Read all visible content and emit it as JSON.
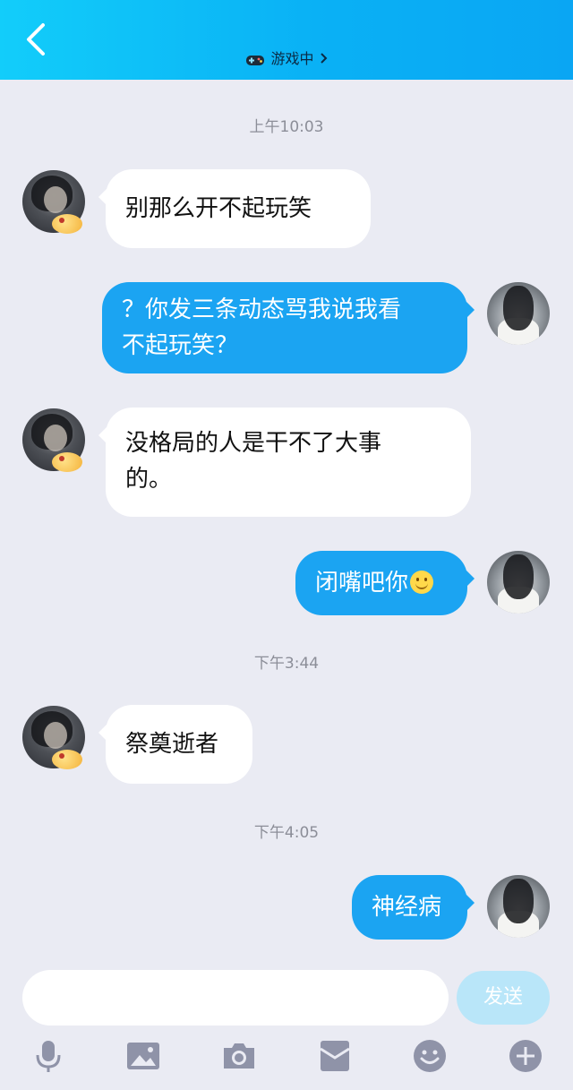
{
  "header": {
    "status_label": "游戏中"
  },
  "timestamps": [
    "上午10:03",
    "下午3:44",
    "下午4:05"
  ],
  "messages": [
    {
      "side": "in",
      "text": "别那么开不起玩笑"
    },
    {
      "side": "out",
      "line1": "？你发三条动态骂我说我看",
      "line2": "不起玩笑？"
    },
    {
      "side": "in",
      "line1": "没格局的人是干不了大事",
      "line2": "的。"
    },
    {
      "side": "out",
      "text": "闭嘴吧你"
    },
    {
      "side": "in",
      "text": "祭奠逝者"
    },
    {
      "side": "out",
      "text": "神经病"
    }
  ],
  "composer": {
    "placeholder": "",
    "send_label": "发送"
  },
  "toolbar": [
    "microphone-icon",
    "image-icon",
    "camera-icon",
    "red-packet-icon",
    "emoji-icon",
    "plus-icon"
  ],
  "colors": {
    "header_start": "#12cdfa",
    "header_end": "#0aa6f3",
    "bubble_out": "#1ba4f2",
    "bubble_in": "#ffffff",
    "send_button": "#b9e6f9",
    "background": "#eaebf3"
  }
}
